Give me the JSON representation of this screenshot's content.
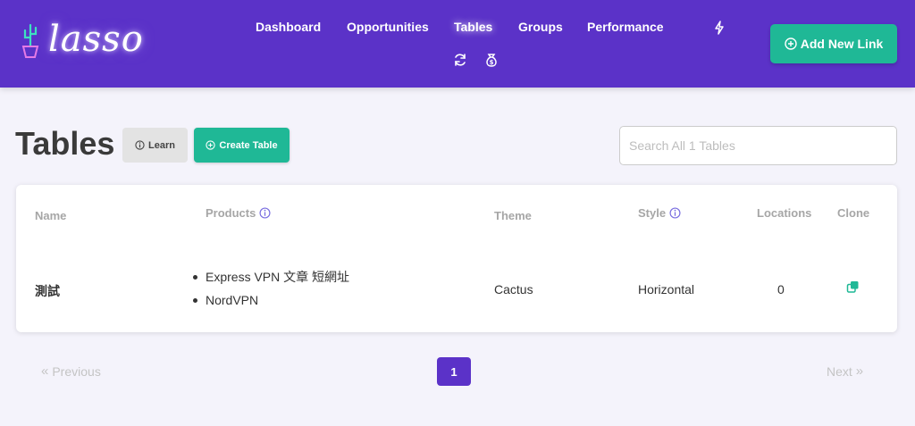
{
  "brand": {
    "logo_text": "lasso"
  },
  "nav": {
    "items": [
      {
        "label": "Dashboard"
      },
      {
        "label": "Opportunities"
      },
      {
        "label": "Tables"
      },
      {
        "label": "Groups"
      },
      {
        "label": "Performance"
      }
    ],
    "icons": [
      "bolt-icon",
      "refresh-icon",
      "money-bag-icon"
    ]
  },
  "header": {
    "add_button_label": "Add New Link"
  },
  "page": {
    "title": "Tables",
    "learn_label": "Learn",
    "create_label": "Create Table",
    "search_placeholder": "Search All 1 Tables"
  },
  "table": {
    "columns": {
      "name": "Name",
      "products": "Products",
      "theme": "Theme",
      "style": "Style",
      "locations": "Locations",
      "clone": "Clone"
    },
    "rows": [
      {
        "name": "測試",
        "products": [
          "Express VPN 文章 短網址",
          "NordVPN"
        ],
        "theme": "Cactus",
        "style": "Horizontal",
        "locations": "0"
      }
    ]
  },
  "pagination": {
    "previous_label": "Previous",
    "next_label": "Next",
    "current_page": "1"
  },
  "colors": {
    "primary": "#5b32c8",
    "accent": "#1fb896",
    "background": "#f4f3fb"
  }
}
